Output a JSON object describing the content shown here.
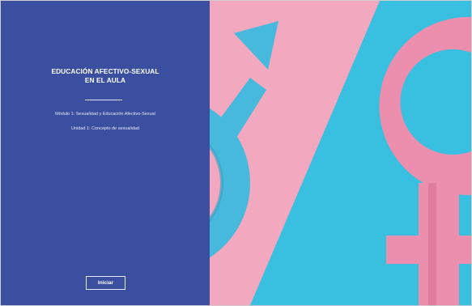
{
  "cover": {
    "title_line1": "EDUCACIÓN AFECTIVO-SEXUAL",
    "title_line2": "EN EL AULA",
    "module": "Módulo 1: Sexualidad y Educación Afectivo-Sexual",
    "unit": "Unidad 1: Concepto de sexualidad",
    "start_button": "Iniciar"
  },
  "colors": {
    "panel": "#3a4f9f",
    "cyan": "#39bfe0",
    "pink": "#f2a8bf",
    "male_symbol": "#46b9dc",
    "female_symbol": "#ec8fae"
  },
  "icons": [
    "male-symbol-icon",
    "female-symbol-icon"
  ]
}
